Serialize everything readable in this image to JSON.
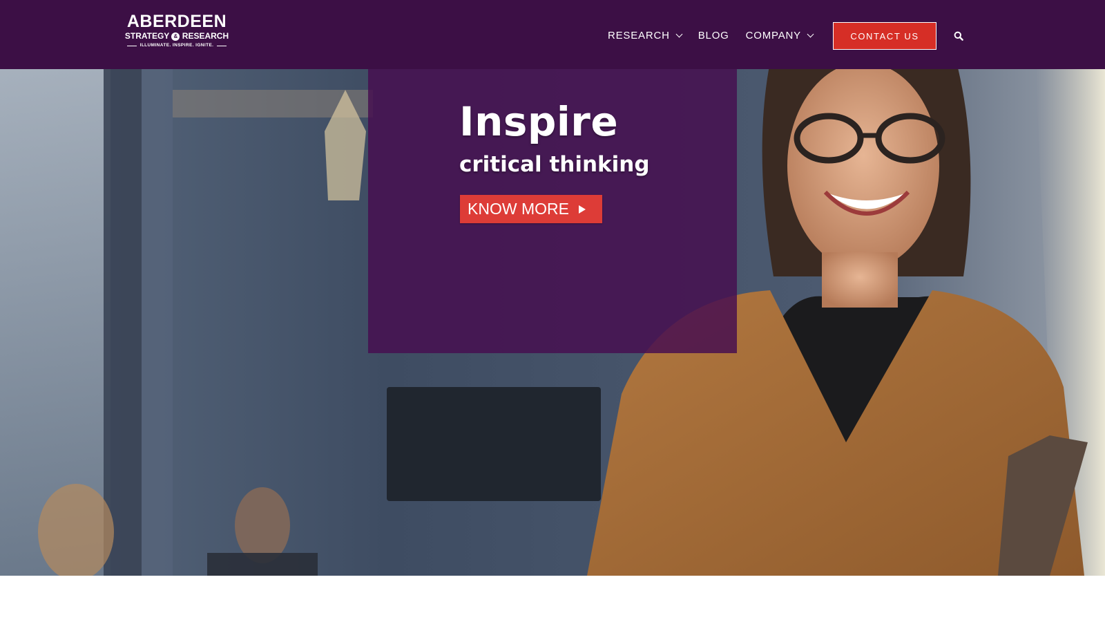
{
  "header": {
    "logo": {
      "name": "ABERDEEN",
      "sub_left": "STRATEGY",
      "sub_amp": "&",
      "sub_right": "RESEARCH",
      "tagline": "ILLUMINATE. INSPIRE. IGNITE."
    },
    "nav": [
      {
        "label": "RESEARCH",
        "has_dropdown": true
      },
      {
        "label": "BLOG",
        "has_dropdown": false
      },
      {
        "label": "COMPANY",
        "has_dropdown": true
      }
    ],
    "contact_label": "CONTACT US",
    "search_icon": "search-icon",
    "background_color": "#3c0f45"
  },
  "hero": {
    "title": "Inspire",
    "subtitle": "critical thinking",
    "cta_label": "KNOW MORE",
    "cta_icon": "play-arrow-icon",
    "overlay_color": "#460e50",
    "cta_color": "#dd3c37",
    "slides": {
      "count": 3,
      "active_index": 1
    }
  },
  "colors": {
    "brand_purple": "#3c0f45",
    "accent_red": "#d62e26"
  }
}
